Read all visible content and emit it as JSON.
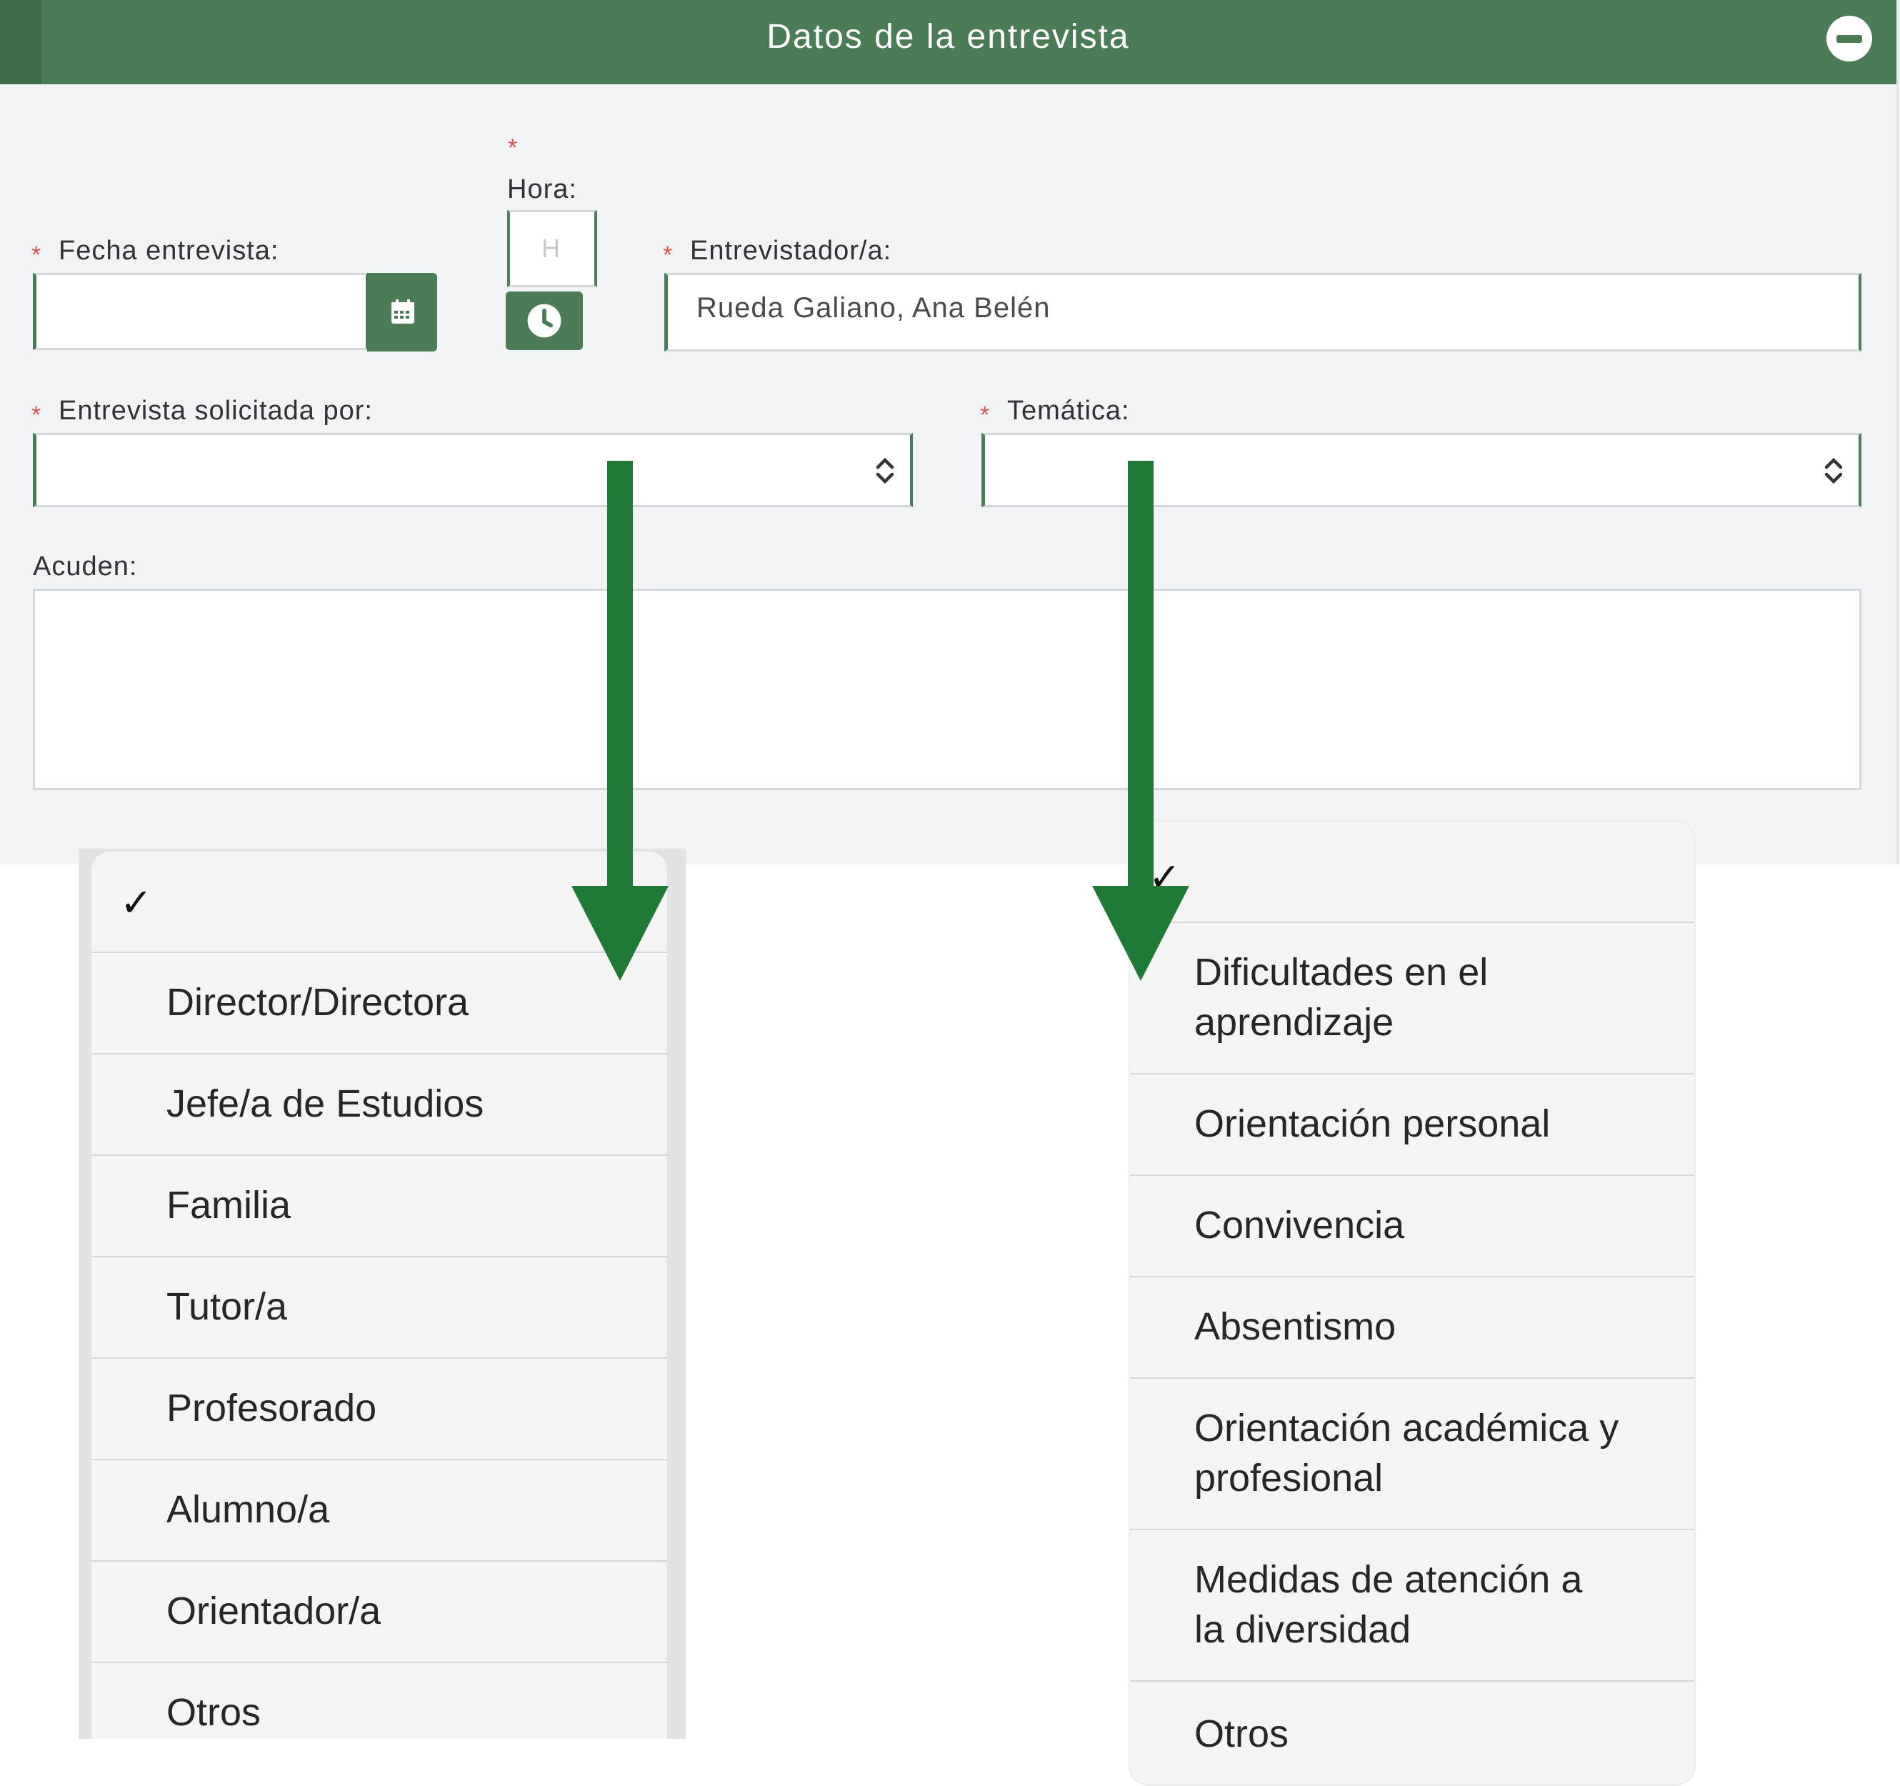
{
  "header": {
    "title": "Datos de la entrevista"
  },
  "form": {
    "required_mark": "*",
    "fecha_label": "Fecha entrevista:",
    "hora_label": "Hora:",
    "hora_placeholder": "H",
    "entrevistador_label": "Entrevistador/a:",
    "entrevistador_value": "Rueda Galiano, Ana Belén",
    "solicitada_label": "Entrevista solicitada por:",
    "tematica_label": "Temática:",
    "acuden_label": "Acuden:"
  },
  "solicitada_menu": {
    "check": "✓",
    "items": [
      "Director/Directora",
      "Jefe/a de Estudios",
      "Familia",
      "Tutor/a",
      "Profesorado",
      "Alumno/a",
      "Orientador/a",
      "Otros"
    ]
  },
  "tematica_menu": {
    "check": "✓",
    "items": [
      {
        "line1": "Dificultades en el",
        "line2": "aprendizaje"
      },
      {
        "line1": "Orientación personal",
        "line2": ""
      },
      {
        "line1": "Convivencia",
        "line2": ""
      },
      {
        "line1": "Absentismo",
        "line2": ""
      },
      {
        "line1": "Orientación académica y",
        "line2": "profesional"
      },
      {
        "line1": "Medidas de atención a",
        "line2": "la diversidad"
      },
      {
        "line1": "Otros",
        "line2": ""
      }
    ]
  },
  "colors": {
    "accent": "#4a7c55",
    "arrow": "#1e7a34",
    "required": "#d9534f"
  },
  "icons": {
    "calendar": "calendar-icon",
    "clock": "clock-icon",
    "collapse": "minus-circle-icon"
  }
}
